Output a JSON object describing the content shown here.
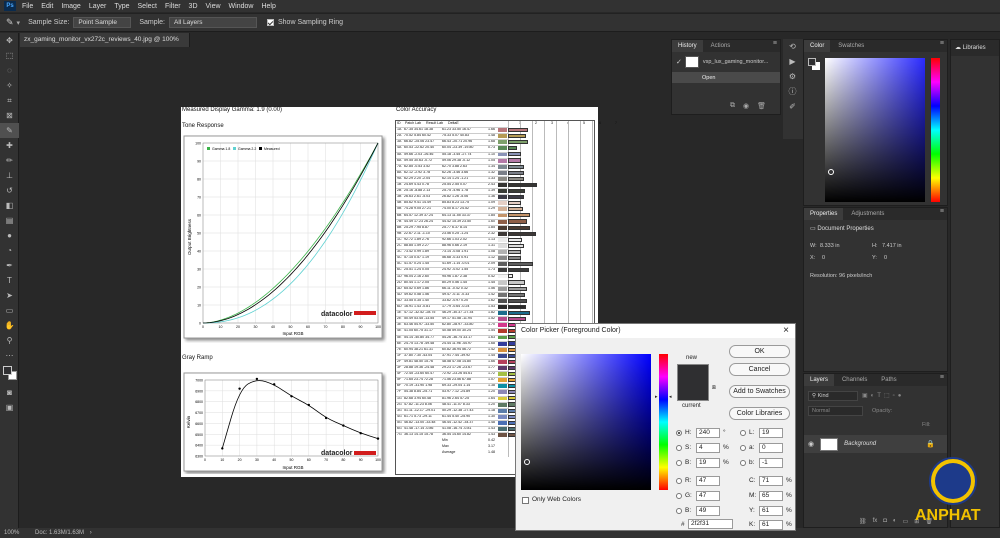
{
  "menu": {
    "logo": "Ps",
    "items": [
      "File",
      "Edit",
      "Image",
      "Layer",
      "Type",
      "Select",
      "Filter",
      "3D",
      "View",
      "Window",
      "Help"
    ]
  },
  "options": {
    "sample_size_label": "Sample Size:",
    "sample_size": "Point Sample",
    "sample_label": "Sample:",
    "sample": "All Layers",
    "show_ring": "Show Sampling Ring"
  },
  "doc_tab": "zx_gaming_monitor_vx272c_reviews_40.jpg @ 100% (RGB/8)",
  "status": {
    "zoom": "100%",
    "doc": "Doc: 1.63M/1.63M"
  },
  "document": {
    "gamma_title": "Measured Display Gamma: 1.9 (0.00)",
    "tone_title": "Tone Response",
    "color_accuracy": "Color Accuracy",
    "gray_ramp": "Gray Ramp",
    "tone_chart": {
      "legend": [
        "Gamma 1.8",
        "Gamma 2.2",
        "Measured"
      ],
      "xlabel": "Input RGB",
      "ylabel": "Output Brightness",
      "xticks": [
        "0",
        "10",
        "20",
        "30",
        "40",
        "50",
        "60",
        "70",
        "80",
        "90",
        "100"
      ],
      "yticks": [
        "0",
        "10",
        "20",
        "30",
        "40",
        "50",
        "60",
        "70",
        "80",
        "90",
        "100"
      ],
      "brand": "datacolor"
    },
    "gray_chart": {
      "xlabel": "Input RGB",
      "ylabel": "Kelvin",
      "xticks": [
        "0",
        "10",
        "20",
        "30",
        "40",
        "50",
        "60",
        "70",
        "80",
        "90",
        "100"
      ],
      "yticks": [
        "6300",
        "6400",
        "6500",
        "6600",
        "6700",
        "6800",
        "6900",
        "7000"
      ],
      "brand": "datacolor"
    },
    "table_header": [
      "ID",
      "Patch Lab",
      "Result Lab",
      "DeltaE",
      "",
      "1",
      "2",
      "3",
      "4",
      "5",
      "6",
      "7"
    ],
    "table_rows": [
      [
        "1A",
        "67.35 34.61 18.38",
        "61.23 33.50 16.47",
        "1.66"
      ],
      [
        "2A",
        "70.52 5.84 60.42",
        "75.33 5.07 40.83",
        "1.48"
      ],
      [
        "3A",
        "66.82 -25.06 23.47",
        "66.43 -20.71 20.96",
        "1.68"
      ],
      [
        "4A",
        "60.53 -22.62 20.40",
        "60.04 -23.39 -19.80",
        "0.73"
      ],
      [
        "5A",
        "59.66 -2.03 -26.46",
        "55.18 -3.45 -27.74",
        "1.10"
      ],
      [
        "6A",
        "59.55 30.63 -0.72",
        "59.06 29.38 -0.12",
        "1.05"
      ],
      [
        "7A",
        "62.85 -0.53 3.52",
        "62.70 3.88 2.63",
        "1.34"
      ],
      [
        "8A",
        "62.12 -2.92 3.78",
        "62.26 -3.46 3.66",
        "1.32"
      ],
      [
        "9A",
        "62.29 2.20 -2.04",
        "62.14 1.24 -1.21",
        "1.33"
      ],
      [
        "1B",
        "24.69 4.43 0.78",
        "25.54 2.55 0.07",
        "2.43"
      ],
      [
        "2B",
        "25.16 -8.88 2.13",
        "25.75 -4.96 1.78",
        "1.39"
      ],
      [
        "3B",
        "26.63 2.61 -5.03",
        "26.82 1.26 -5.06",
        "1.36"
      ],
      [
        "4B",
        "85.62 9.41 14.49",
        "85.83 8.23 13.75",
        "1.09"
      ],
      [
        "5B",
        "74.28 9.05 27.21",
        "74.00 8.17 24.52",
        "1.29"
      ],
      [
        "6B",
        "64.57 12.39 37.24",
        "64.13 11.55 33.37",
        "1.85"
      ],
      [
        "7B",
        "44.49 17.23 26.24",
        "44.42 15.39 23.50",
        "1.60"
      ],
      [
        "8B",
        "25.29 7.95 8.87",
        "25.77 6.37 8.14",
        "1.85"
      ],
      [
        "9B",
        "22.67 2.11 -1.10",
        "23.56 0.25 -1.24",
        "2.32"
      ],
      [
        "1C",
        "92.72 1.89 2.76",
        "92.66 1.03 2.02",
        "1.13"
      ],
      [
        "2C",
        "88.85 1.59 2.27",
        "88.96 0.66 2.19",
        "1.31"
      ],
      [
        "3C",
        "73.42 0.99 1.89",
        "73.14 -0.08 1.91",
        "1.08"
      ],
      [
        "4C",
        "57.15 0.57 1.19",
        "56.68 -0.33 0.91",
        "1.12"
      ],
      [
        "5C",
        "41.57 0.24 1.45",
        "41.69 -1.14 -0.01",
        "2.09"
      ],
      [
        "6C",
        "25.51 1.24 0.05",
        "24.92 -0.02 1.55",
        "1.73"
      ],
      [
        "1D",
        "96.04 2.16 2.60",
        "95.96 1.87 2.38",
        "0.42"
      ],
      [
        "2D",
        "80.44 1.17 2.05",
        "80.29 0.56 1.45",
        "1.45"
      ],
      [
        "3D",
        "65.52 0.69 1.86",
        "66.11 -0.42 0.32",
        "1.56"
      ],
      [
        "4D",
        "49.62 0.58 1.56",
        "49.47 -0.11 -0.33",
        "1.42"
      ],
      [
        "5D",
        "33.55 0.35 1.40",
        "33.62 -0.97 0.20",
        "1.62"
      ],
      [
        "6D",
        "16.91 1.43 -0.81",
        "17.79 -0.64 -0.24",
        "1.53"
      ],
      [
        "1E",
        "47.12 -32.52 -28.75",
        "46.29 -30.37 -27.34",
        "1.82"
      ],
      [
        "2E",
        "50.49 53.45 -13.55",
        "49.17 51.58 -11.94",
        "1.52"
      ],
      [
        "3E",
        "63.46 54.97 -33.50",
        "62.80 -28.97 -33.80",
        "1.70"
      ],
      [
        "4E",
        "41.05 60.75 31.17",
        "40.58 59.00 30.24",
        "1.54"
      ],
      [
        "5E",
        "54.14 -40.80 34.77",
        "54.26 -36.74 33.17",
        "1.63"
      ],
      [
        "6E",
        "24.75 13.78 -49.48",
        "24.44 11.96 -44.97",
        "1.68"
      ],
      [
        "7E",
        "60.94 38.21 61.31",
        "60.82 36.94 56.72",
        "1.42"
      ],
      [
        "1F",
        "37.80 7.30 -43.04",
        "37.91 7.44 -39.92",
        "1.45"
      ],
      [
        "2F",
        "49.81 48.50 15.76",
        "48.58 47.08 14.80",
        "1.66"
      ],
      [
        "3F",
        "28.88 19.36 -24.48",
        "29.23 17.26 -23.67",
        "1.77"
      ],
      [
        "4F",
        "72.45 -23.60 60.47",
        "72.92 -23.26 54.61",
        "1.72"
      ],
      [
        "5F",
        "71.65 23.74 72.28",
        "71.56 23.56 67.88",
        "1.07"
      ],
      [
        "6F",
        "70.19 -31.90 1.98",
        "69.33 -29.04 1.14",
        "1.38"
      ],
      [
        "7F",
        "54.38 8.84 -25.71",
        "53.97 7.12 -24.89",
        "1.20"
      ],
      [
        "1G",
        "82.68 3.94 60.48",
        "81.96 2.64 57.25",
        "1.64"
      ],
      [
        "2G",
        "47.82 -11.23 8.06",
        "48.41 -11.07 8.33",
        "1.20"
      ],
      [
        "3G",
        "51.11 -12.17 -29.01",
        "50.29 -12.38 -27.43",
        "1.18"
      ],
      [
        "4G",
        "61.71 5.73 -29.11",
        "61.44 5.40 -25.90",
        "1.30"
      ],
      [
        "5G",
        "46.82 -13.00 -33.48",
        "46.44 -12.42 -34.37",
        "1.48"
      ],
      [
        "6G",
        "41.48 -17.14 -0.86",
        "41.08 -16.74 -0.81",
        "1.43"
      ],
      [
        "7G",
        "36.13 14.15 15.78",
        "36.54 14.60 14.82",
        "1.43"
      ]
    ],
    "bar_colors": [
      "#b8767b",
      "#b49a55",
      "#7ea06b",
      "#5b8a58",
      "#8a93b7",
      "#b57aa8",
      "#7f8a92",
      "#7b7f88",
      "#8c8a84",
      "#363533",
      "#3a3d36",
      "#3d3c46",
      "#e5cfc6",
      "#d3b198",
      "#c4946a",
      "#8e5f48",
      "#4a3c33",
      "#3d3836",
      "#ececec",
      "#dedede",
      "#b1b1b1",
      "#888888",
      "#5e5e5e",
      "#3c3c3c",
      "#f3f3f3",
      "#c8c8c8",
      "#9c9c9c",
      "#747474",
      "#4f4f4f",
      "#2b2b2b",
      "#1b6c8c",
      "#b34a8a",
      "#d4388c",
      "#b43a2c",
      "#5d9e4a",
      "#323c9b",
      "#d8903a",
      "#3b4a8f",
      "#b5405c",
      "#5e3b6b",
      "#a3c045",
      "#e1a233",
      "#0d90a5",
      "#8c88b5",
      "#d9cc3c",
      "#5e7a63",
      "#5c7da9",
      "#7a8ac0",
      "#4c6fb4",
      "#4a6c6f",
      "#6e5344"
    ],
    "bar_values": [
      1.66,
      1.48,
      1.68,
      0.73,
      1.1,
      1.05,
      1.34,
      1.32,
      1.33,
      2.43,
      1.39,
      1.36,
      1.09,
      1.29,
      1.85,
      1.6,
      1.85,
      2.32,
      1.13,
      1.31,
      1.08,
      1.12,
      2.09,
      1.73,
      0.42,
      1.45,
      1.56,
      1.42,
      1.62,
      1.53,
      1.82,
      1.52,
      1.7,
      1.54,
      1.63,
      1.68,
      1.42,
      1.45,
      1.66,
      1.77,
      1.72,
      1.07,
      1.38,
      1.2,
      1.64,
      1.2,
      1.18,
      1.3,
      1.48,
      1.43,
      1.43
    ],
    "summary": [
      [
        "Min",
        "0.42"
      ],
      [
        "Max",
        "3.17"
      ],
      [
        "Average",
        "1.48"
      ]
    ]
  },
  "history": {
    "tabs": [
      "History",
      "Actions"
    ],
    "snapshot": "vsp_lux_gaming_monitor...",
    "step": "Open"
  },
  "color": {
    "tabs": [
      "Color",
      "Swatches"
    ]
  },
  "libraries": "Libraries",
  "properties": {
    "tabs": [
      "Properties",
      "Adjustments"
    ],
    "title": "Document Properties",
    "w_label": "W:",
    "w": "8.333 in",
    "h_label": "H:",
    "h": "7.417 in",
    "x_label": "X:",
    "x": "0",
    "y_label": "Y:",
    "y": "0",
    "resolution": "Resolution: 96 pixels/inch"
  },
  "layers": {
    "tabs": [
      "Layers",
      "Channels",
      "Paths"
    ],
    "kind": "Kind",
    "blend": "Normal",
    "opacity_label": "Opacity:",
    "fill_label": "Fill:",
    "layer": "Background"
  },
  "picker": {
    "title": "Color Picker (Foreground Color)",
    "ok": "OK",
    "cancel": "Cancel",
    "add_swatches": "Add to Swatches",
    "libraries": "Color Libraries",
    "new_label": "new",
    "current_label": "current",
    "H": "240",
    "S": "4",
    "Bv": "19",
    "R": "47",
    "G": "47",
    "Bc": "49",
    "L": "19",
    "a": "0",
    "b": "-1",
    "C": "71",
    "M": "65",
    "Y": "61",
    "K": "61",
    "hex": "2f2f31",
    "only_web": "Only Web Colors",
    "deg": "°",
    "pct": "%",
    "labels": {
      "H": "H:",
      "S": "S:",
      "Bv": "B:",
      "R": "R:",
      "G": "G:",
      "Bc": "B:",
      "L": "L:",
      "a": "a:",
      "b": "b:",
      "C": "C:",
      "M": "M:",
      "Y": "Y:",
      "K": "K:",
      "hex": "#"
    }
  },
  "watermark": "ANPHAT"
}
